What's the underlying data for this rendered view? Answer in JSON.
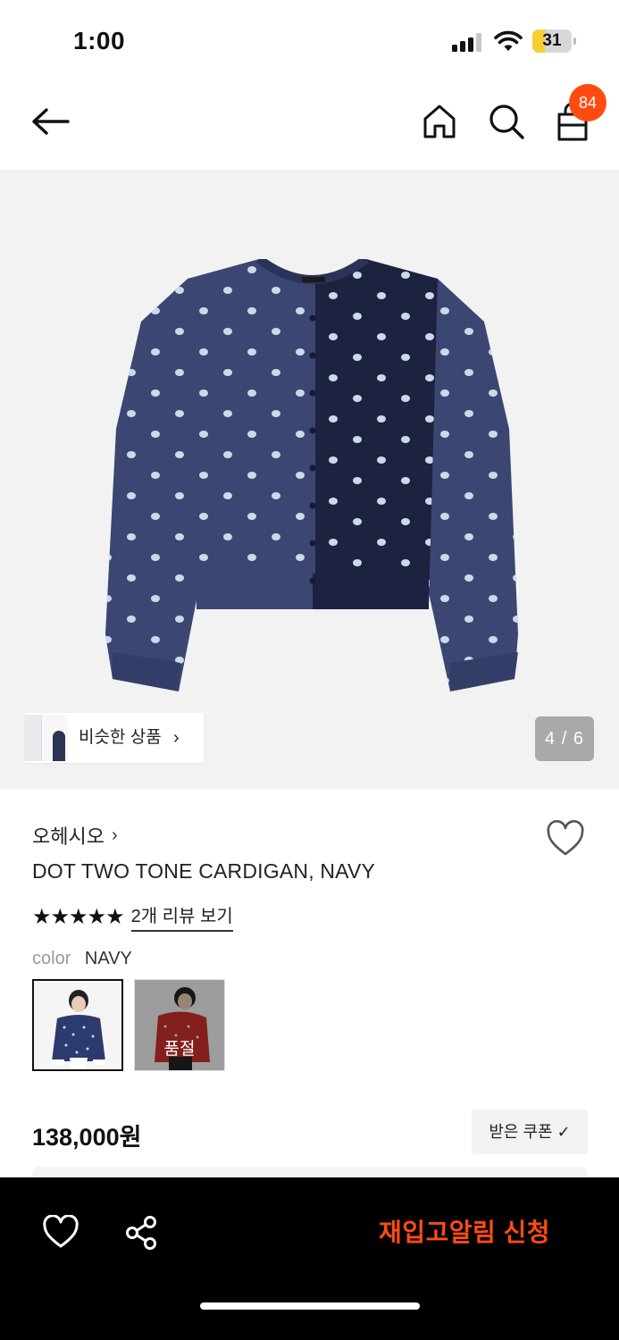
{
  "status_bar": {
    "time": "1:00",
    "battery_level": "31",
    "icons": [
      "cellular-signal-icon",
      "wifi-icon",
      "battery-icon"
    ]
  },
  "nav": {
    "icons": [
      "back-arrow-icon",
      "home-icon",
      "search-icon",
      "shopping-bag-icon"
    ],
    "cart_count": "84"
  },
  "gallery": {
    "similar_label": "비슷한 상품",
    "similar_chevron": "›",
    "page_indicator": "4 / 6",
    "image_subject": "cardigan-navy-dots",
    "colors": {
      "navy_left": "#3b4673",
      "navy_right": "#1c2240",
      "dot": "#c9dbe9",
      "background": "#f2f2f2"
    }
  },
  "product": {
    "brand": "오헤시오",
    "brand_chevron": "›",
    "name": "DOT TWO TONE CARDIGAN, NAVY",
    "stars": "★★★★★",
    "rating": 5,
    "review_link": "2개 리뷰 보기",
    "color_label": "color",
    "color_value": "NAVY",
    "swatches": [
      {
        "color": "navy",
        "selected": true,
        "sold_out": false
      },
      {
        "color": "red",
        "selected": false,
        "sold_out": true,
        "sold_out_label": "품절"
      }
    ],
    "price": "138,000원",
    "coupon_button": "받은 쿠폰 ✓"
  },
  "bottom_bar": {
    "icons": [
      "heart-icon",
      "share-icon"
    ],
    "restock_button": "재입고알림 신청",
    "accent": "#ff4b12"
  }
}
